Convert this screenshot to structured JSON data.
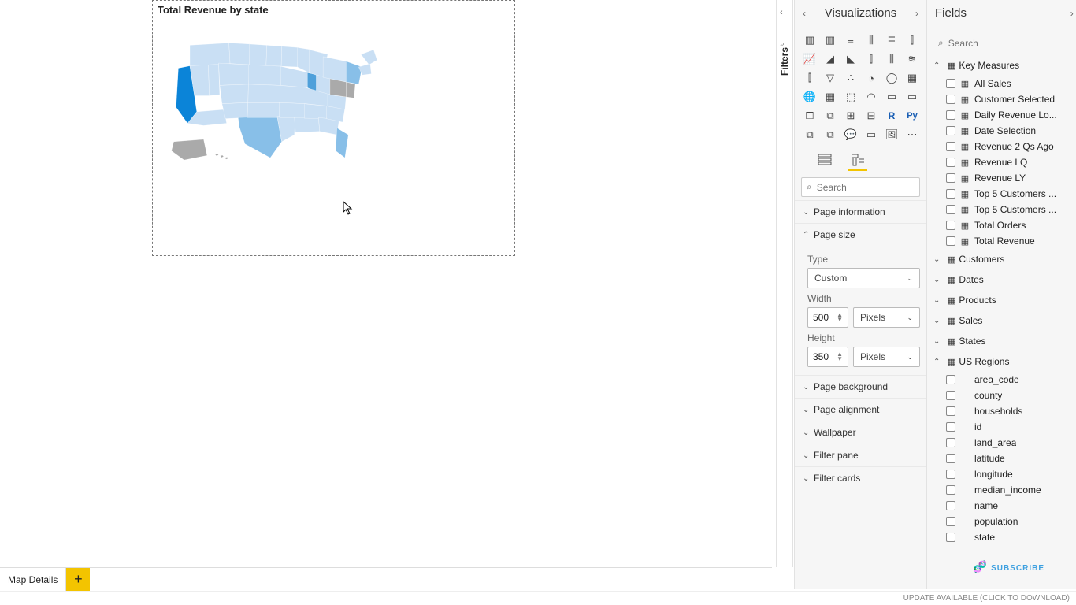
{
  "visual": {
    "title": "Total Revenue by state"
  },
  "page_tabs": {
    "current": "Map Details"
  },
  "filters": {
    "label": "Filters"
  },
  "viz_panel": {
    "title": "Visualizations",
    "search_placeholder": "Search",
    "groups": {
      "page_info": "Page information",
      "page_size": "Page size",
      "page_bg": "Page background",
      "page_align": "Page alignment",
      "wallpaper": "Wallpaper",
      "filter_pane": "Filter pane",
      "filter_cards": "Filter cards"
    },
    "page_size": {
      "type_label": "Type",
      "type_value": "Custom",
      "width_label": "Width",
      "width_value": "500",
      "width_unit": "Pixels",
      "height_label": "Height",
      "height_value": "350",
      "height_unit": "Pixels"
    }
  },
  "fields_panel": {
    "title": "Fields",
    "search_placeholder": "Search",
    "key_measures": {
      "label": "Key Measures",
      "items": [
        "All Sales",
        "Customer Selected",
        "Daily Revenue Lo...",
        "Date Selection",
        "Revenue 2 Qs Ago",
        "Revenue LQ",
        "Revenue LY",
        "Top 5 Customers ...",
        "Top 5 Customers ...",
        "Total Orders",
        "Total Revenue"
      ]
    },
    "tables": [
      "Customers",
      "Dates",
      "Products",
      "Sales",
      "States"
    ],
    "us_regions": {
      "label": "US Regions",
      "items": [
        "area_code",
        "county",
        "households",
        "id",
        "land_area",
        "latitude",
        "longitude",
        "median_income",
        "name",
        "population",
        "state"
      ]
    }
  },
  "statusbar": {
    "update": "UPDATE AVAILABLE (CLICK TO DOWNLOAD)"
  },
  "watermark": "SUBSCRIBE"
}
